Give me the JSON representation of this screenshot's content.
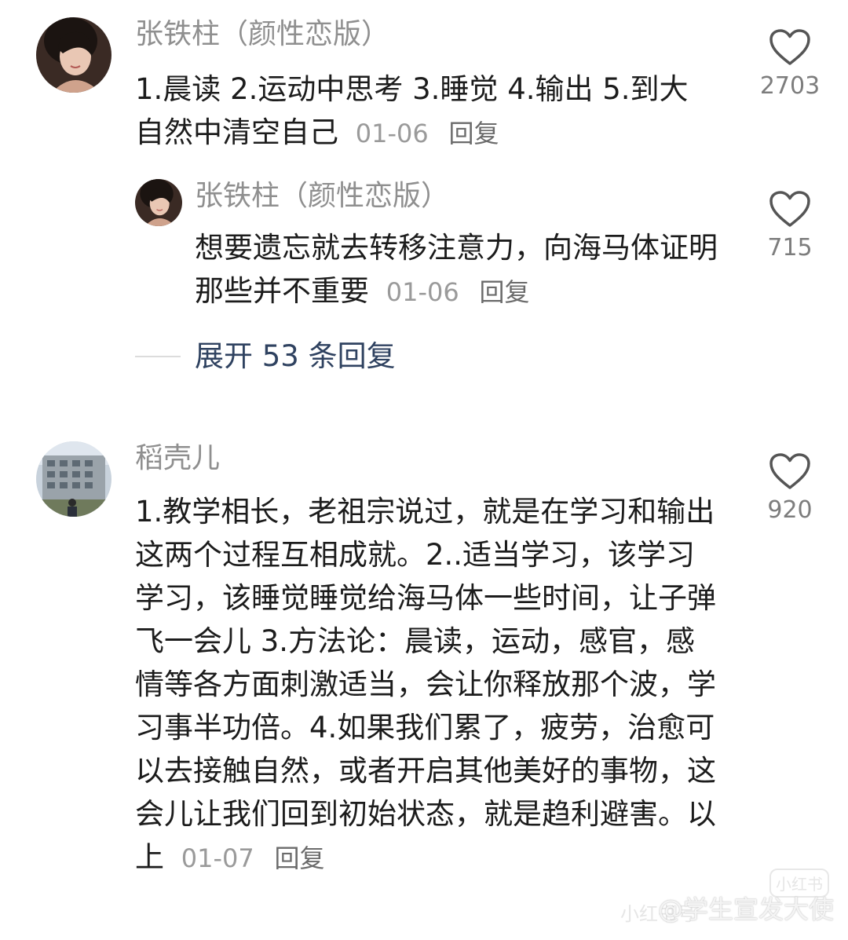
{
  "comments": [
    {
      "user": "张铁柱（颜性恋版）",
      "text": "1.晨读 2.运动中思考 3.睡觉 4.输出 5.到大自然中清空自己",
      "date": "01-06",
      "reply_label": "回复",
      "likes": "2703",
      "replies": [
        {
          "user": "张铁柱（颜性恋版）",
          "text": "想要遗忘就去转移注意力，向海马体证明那些并不重要",
          "date": "01-06",
          "reply_label": "回复",
          "likes": "715"
        }
      ],
      "expand_label": "展开 53 条回复"
    },
    {
      "user": "稻壳儿",
      "text": "1.教学相长，老祖宗说过，就是在学习和输出这两个过程互相成就。2..适当学习，该学习学习，该睡觉睡觉给海马体一些时间，让子弹飞一会儿 3.方法论：晨读，运动，感官，感情等各方面刺激适当，会让你释放那个波，学习事半功倍。4.如果我们累了，疲劳，治愈可以去接触自然，或者开启其他美好的事物，这会儿让我们回到初始状态，就是趋利避害。以上",
      "date": "01-07",
      "reply_label": "回复",
      "likes": "920"
    }
  ],
  "watermark": {
    "small_logo": "小红书",
    "faint": "小红书号",
    "brand": "@学生宣发大使"
  },
  "colors": {
    "link": "#2f4260",
    "meta": "#9a9a9a",
    "text": "#1c1c1c"
  }
}
